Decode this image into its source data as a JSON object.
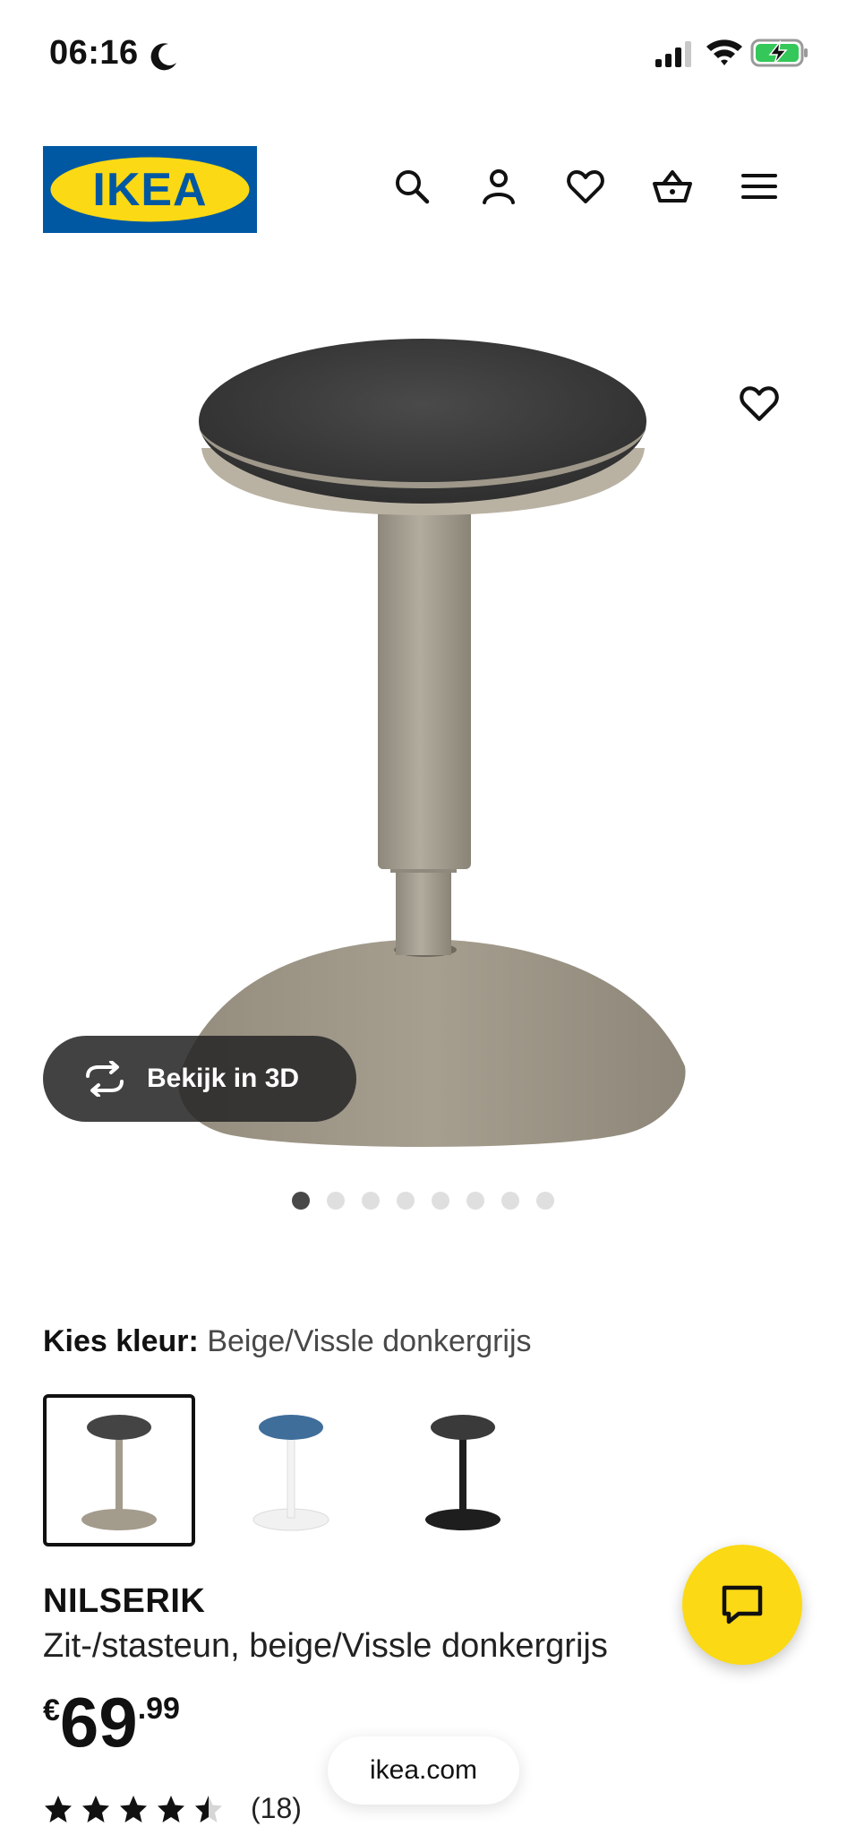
{
  "status_bar": {
    "time": "06:16",
    "icons": [
      "moon-icon",
      "signal-icon",
      "wifi-icon",
      "battery-charging-icon"
    ]
  },
  "header": {
    "logo_text": "IKEA",
    "icons": [
      "search-icon",
      "account-icon",
      "heart-icon",
      "cart-icon",
      "menu-icon"
    ]
  },
  "gallery": {
    "view_3d_label": "Bekijk in 3D",
    "dot_count": 8,
    "active_dot": 1
  },
  "color_choice": {
    "label": "Kies kleur:",
    "value": "Beige/Vissle donkergrijs",
    "options": [
      {
        "name": "beige-grey",
        "selected": true
      },
      {
        "name": "blue-white",
        "selected": false
      },
      {
        "name": "black",
        "selected": false
      }
    ]
  },
  "product": {
    "name": "NILSERIK",
    "description": "Zit-/stasteun, beige/Vissle donkergrijs",
    "price_currency": "€",
    "price_int": "69",
    "price_dec": ".99",
    "rating_value": 4.5,
    "rating_count": "(18)"
  },
  "browser": {
    "url": "ikea.com"
  },
  "colors": {
    "ikea_blue": "#0058a3",
    "ikea_yellow": "#fbd914",
    "seat_grey": "#3f3f3f",
    "base_beige": "#a39b8c"
  }
}
